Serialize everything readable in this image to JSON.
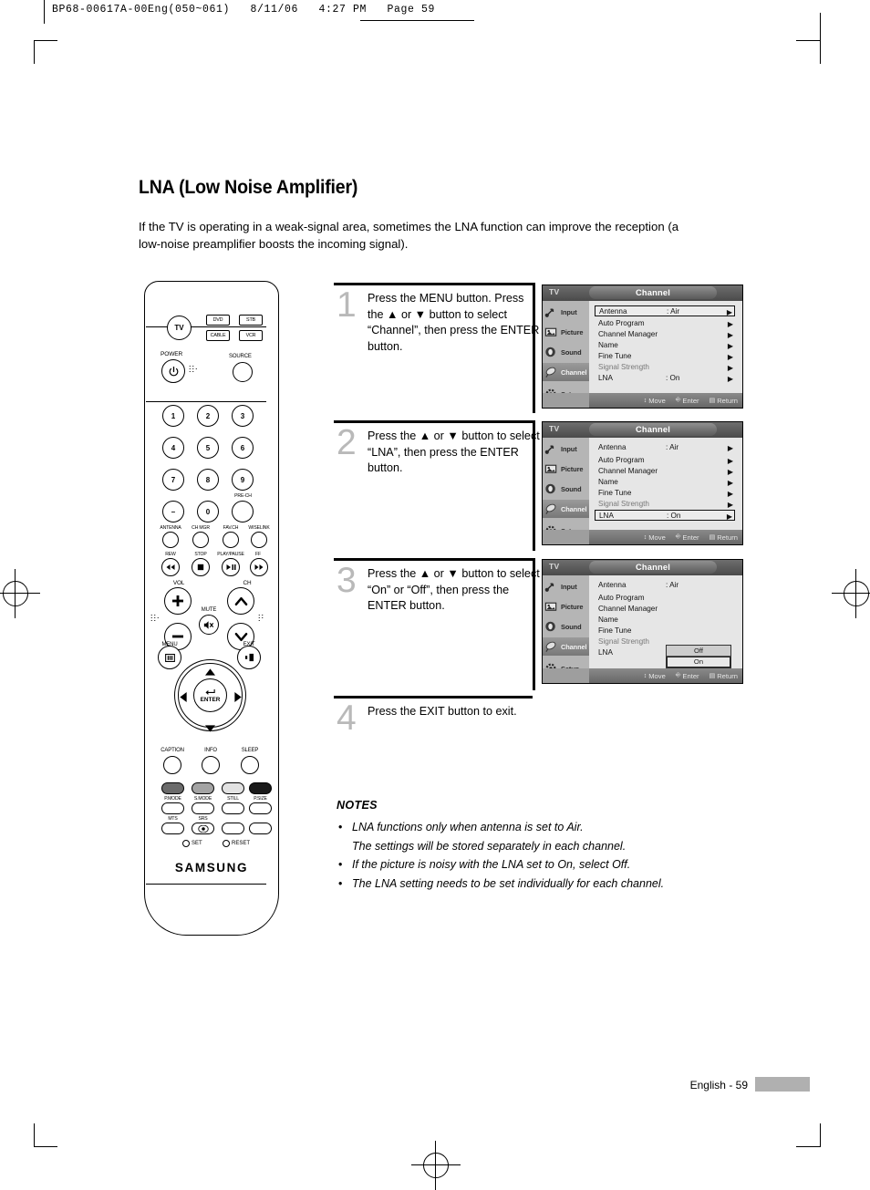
{
  "print_header": "BP68-00617A-00Eng(050~061)   8/11/06   4:27 PM   Page 59",
  "page": {
    "title": "LNA (Low Noise Amplifier)",
    "intro": "If the TV is operating in a weak-signal area, sometimes the LNA function can improve the reception (a low-noise preamplifier boosts the incoming signal).",
    "footer_label": "English - 59"
  },
  "steps": [
    {
      "num": "1",
      "text": "Press the MENU button. Press the ▲ or ▼ button to select “Channel”, then press the ENTER button."
    },
    {
      "num": "2",
      "text": "Press the ▲ or ▼ button to select “LNA”, then press the ENTER button."
    },
    {
      "num": "3",
      "text": "Press the ▲ or ▼ button to select “On” or “Off”, then press the ENTER button."
    },
    {
      "num": "4",
      "text": "Press the EXIT button to exit."
    }
  ],
  "osd": {
    "device_label": "TV",
    "title": "Channel",
    "sidebar": [
      {
        "label": "Input",
        "icon": "input-icon"
      },
      {
        "label": "Picture",
        "icon": "picture-icon"
      },
      {
        "label": "Sound",
        "icon": "sound-icon"
      },
      {
        "label": "Channel",
        "icon": "channel-icon"
      },
      {
        "label": "Setup",
        "icon": "setup-icon"
      }
    ],
    "selected_sidebar": "Channel",
    "rows": [
      {
        "label": "Antenna",
        "value": ": Air",
        "dim": false
      },
      {
        "label": "Auto Program",
        "value": "",
        "dim": false
      },
      {
        "label": "Channel Manager",
        "value": "",
        "dim": false
      },
      {
        "label": "Name",
        "value": "",
        "dim": false
      },
      {
        "label": "Fine Tune",
        "value": "",
        "dim": false
      },
      {
        "label": "Signal Strength",
        "value": "",
        "dim": true
      },
      {
        "label": "LNA",
        "value": ": On",
        "dim": false
      }
    ],
    "bottom_bar": [
      {
        "icon": "↕",
        "label": "Move"
      },
      {
        "icon": "↵",
        "label": "Enter"
      },
      {
        "icon": "⌸",
        "label": "Return"
      }
    ],
    "popup_options": [
      "Off",
      "On"
    ],
    "popup_selected": "On",
    "screen1_highlight": "Antenna",
    "screen2_highlight": "LNA"
  },
  "notes": {
    "heading": "NOTES",
    "items": [
      {
        "text": "LNA functions only when antenna is set to Air.",
        "sub": "The settings will be stored separately in each channel."
      },
      {
        "text": "If the picture is noisy with the LNA set to On, select Off.",
        "sub": ""
      },
      {
        "text": "The LNA setting needs to be set individually for each channel.",
        "sub": ""
      }
    ]
  },
  "remote": {
    "brand": "SAMSUNG",
    "mode_buttons": [
      "TV",
      "DVD",
      "STB",
      "CABLE",
      "VCR"
    ],
    "power_label": "POWER",
    "source_label": "SOURCE",
    "keys": [
      "1",
      "2",
      "3",
      "4",
      "5",
      "6",
      "7",
      "8",
      "9",
      "–",
      "0",
      ""
    ],
    "prech_label": "PRE-CH",
    "fn_row1": [
      "ANTENNA",
      "CH MGR",
      "FAV.CH",
      "WISELINK"
    ],
    "transport": [
      "REW",
      "STOP",
      "PLAY/PAUSE",
      "FF"
    ],
    "vol_label": "VOL",
    "ch_label": "CH",
    "mute_label": "MUTE",
    "menu_label": "MENU",
    "exit_label": "EXIT",
    "enter_label": "ENTER",
    "fn_row2": [
      "CAPTION",
      "INFO",
      "SLEEP"
    ],
    "color_row": [
      "P.MODE",
      "S.MODE",
      "STILL",
      "P.SIZE"
    ],
    "color_values": [
      "#6b6b6b",
      "#a3a3a3",
      "#e2e2e2",
      "#1a1a1a"
    ],
    "fn_row3": [
      "MTS",
      "SRS"
    ],
    "set_label": "SET",
    "reset_label": "RESET"
  }
}
